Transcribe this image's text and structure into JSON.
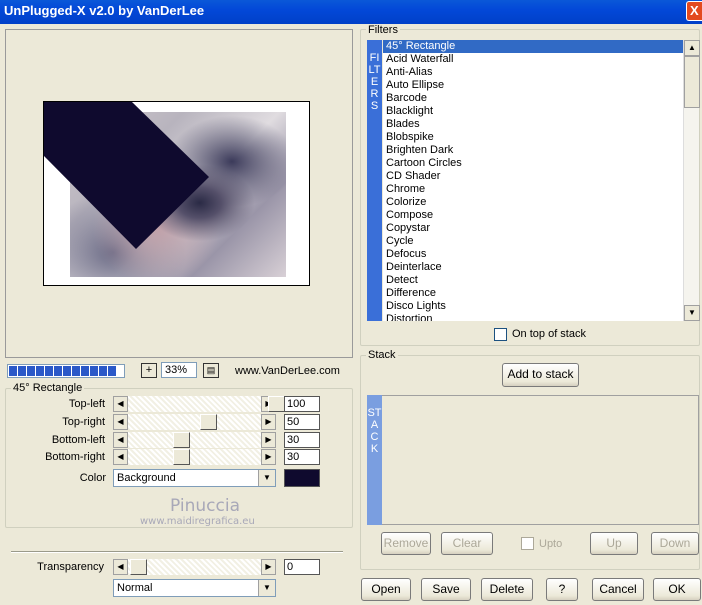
{
  "window": {
    "title": "UnPlugged-X v2.0 by VanDerLee",
    "close_glyph": "X"
  },
  "toolbar": {
    "zoom_in": "+",
    "zoom_value": "33%",
    "website": "www.VanDerLee.com"
  },
  "progress": {
    "value": 1.0
  },
  "settings": {
    "group_label": "45° Rectangle",
    "rows": [
      {
        "label": "Top-left",
        "value": "100"
      },
      {
        "label": "Top-right",
        "value": "50"
      },
      {
        "label": "Bottom-left",
        "value": "30"
      },
      {
        "label": "Bottom-right",
        "value": "30"
      }
    ],
    "color_label": "Color",
    "color_mode": "Background",
    "swatch_color": "#0f0a2e",
    "transparency_label": "Transparency",
    "transparency_value": "0",
    "blend_mode": "Normal"
  },
  "watermark": {
    "name": "Pinuccia",
    "url": "www.maidiregrafica.eu"
  },
  "filters": {
    "group_label": "Filters",
    "side_label": "FILTERS",
    "items": [
      "45° Rectangle",
      "Acid Waterfall",
      "Anti-Alias",
      "Auto Ellipse",
      "Barcode",
      "Blacklight",
      "Blades",
      "Blobspike",
      "Brighten Dark",
      "Cartoon Circles",
      "CD Shader",
      "Chrome",
      "Colorize",
      "Compose",
      "Copystar",
      "Cycle",
      "Defocus",
      "Deinterlace",
      "Detect",
      "Difference",
      "Disco Lights",
      "Distortion"
    ],
    "selected_index": 0,
    "on_top_label": "On top of stack"
  },
  "stack": {
    "group_label": "Stack",
    "add_label": "Add to stack",
    "side_label": "STACK",
    "remove_label": "Remove",
    "clear_label": "Clear",
    "upto_label": "Upto",
    "up_label": "Up",
    "down_label": "Down"
  },
  "footer": {
    "open": "Open",
    "save": "Save",
    "delete": "Delete",
    "help": "?",
    "cancel": "Cancel",
    "ok": "OK"
  },
  "colors": {
    "accent": "#316ac5",
    "swatch": "#0f0a2e",
    "side_bar": "#3a6fd8"
  }
}
